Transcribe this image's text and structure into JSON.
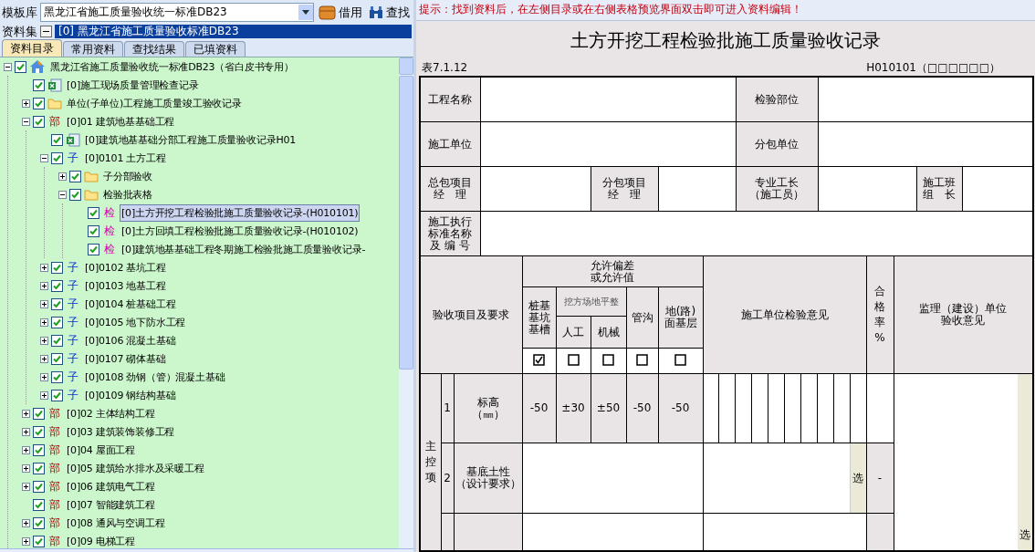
{
  "toolbar": {
    "template_label": "模板库",
    "template_value": "黑龙江省施工质量验收统一标准DB23",
    "borrow_button": "借用",
    "find_button": "查找"
  },
  "dataset": {
    "label": "资料集",
    "value": "[0] 黑龙江省施工质量验收标准DB23"
  },
  "tabs": [
    {
      "label": "资料目录",
      "selected": true
    },
    {
      "label": "常用资料",
      "selected": false
    },
    {
      "label": "查找结果",
      "selected": false
    },
    {
      "label": "已填资料",
      "selected": false
    }
  ],
  "tree": [
    {
      "kind": "root",
      "label": "黑龙江省施工质量验收统一标准DB23（省白皮书专用）",
      "checked": true,
      "expanded": true,
      "selected": false,
      "children": [
        {
          "kind": "file",
          "label": "[0]施工现场质量管理检查记录",
          "checked": true,
          "selected": false
        },
        {
          "kind": "folder",
          "label": "单位(子单位)工程施工质量竣工验收记录",
          "checked": true,
          "expanded": false,
          "selected": false
        },
        {
          "kind": "part",
          "tag": "部",
          "label": "[0]01 建筑地基基础工程",
          "checked": true,
          "expanded": true,
          "selected": false,
          "children": [
            {
              "kind": "file",
              "label": "[0]建筑地基基础分部工程施工质量验收记录H01",
              "checked": true,
              "selected": false
            },
            {
              "kind": "sub",
              "tag": "子",
              "label": "[0]0101 土方工程",
              "checked": true,
              "expanded": true,
              "selected": false,
              "children": [
                {
                  "kind": "folder",
                  "label": "子分部验收",
                  "checked": true,
                  "expanded": false,
                  "selected": false
                },
                {
                  "kind": "folder",
                  "label": "检验批表格",
                  "checked": true,
                  "expanded": true,
                  "selected": false,
                  "children": [
                    {
                      "kind": "check",
                      "tag": "检",
                      "label": "[0]土方开挖工程检验批施工质量验收记录-(H010101)",
                      "checked": true,
                      "selected": true
                    },
                    {
                      "kind": "check",
                      "tag": "检",
                      "label": "[0]土方回填工程检验批施工质量验收记录-(H010102)",
                      "checked": true,
                      "selected": false
                    },
                    {
                      "kind": "check",
                      "tag": "检",
                      "label": "[0]建筑地基基础工程冬期施工检验批施工质量验收记录-",
                      "checked": true,
                      "selected": false
                    }
                  ]
                }
              ]
            },
            {
              "kind": "sub",
              "tag": "子",
              "label": "[0]0102 基坑工程",
              "checked": true,
              "expanded": false,
              "selected": false
            },
            {
              "kind": "sub",
              "tag": "子",
              "label": "[0]0103 地基工程",
              "checked": true,
              "expanded": false,
              "selected": false
            },
            {
              "kind": "sub",
              "tag": "子",
              "label": "[0]0104 桩基础工程",
              "checked": true,
              "expanded": false,
              "selected": false
            },
            {
              "kind": "sub",
              "tag": "子",
              "label": "[0]0105 地下防水工程",
              "checked": true,
              "expanded": false,
              "selected": false
            },
            {
              "kind": "sub",
              "tag": "子",
              "label": "[0]0106 混凝土基础",
              "checked": true,
              "expanded": false,
              "selected": false
            },
            {
              "kind": "sub",
              "tag": "子",
              "label": "[0]0107 砌体基础",
              "checked": true,
              "expanded": false,
              "selected": false
            },
            {
              "kind": "sub",
              "tag": "子",
              "label": "[0]0108 劲钢（管）混凝土基础",
              "checked": true,
              "expanded": false,
              "selected": false
            },
            {
              "kind": "sub",
              "tag": "子",
              "label": "[0]0109 钢结构基础",
              "checked": true,
              "expanded": false,
              "selected": false
            }
          ]
        },
        {
          "kind": "part",
          "tag": "部",
          "label": "[0]02 主体结构工程",
          "checked": true,
          "expanded": false,
          "selected": false
        },
        {
          "kind": "part",
          "tag": "部",
          "label": "[0]03 建筑装饰装修工程",
          "checked": true,
          "expanded": false,
          "selected": false
        },
        {
          "kind": "part",
          "tag": "部",
          "label": "[0]04 屋面工程",
          "checked": true,
          "expanded": false,
          "selected": false
        },
        {
          "kind": "part",
          "tag": "部",
          "label": "[0]05 建筑给水排水及采暖工程",
          "checked": true,
          "expanded": false,
          "selected": false
        },
        {
          "kind": "part",
          "tag": "部",
          "label": "[0]06 建筑电气工程",
          "checked": true,
          "expanded": false,
          "selected": false
        },
        {
          "kind": "part",
          "tag": "部",
          "label": "[0]07 智能建筑工程",
          "checked": true,
          "selected": false
        },
        {
          "kind": "part",
          "tag": "部",
          "label": "[0]08 通风与空调工程",
          "checked": true,
          "expanded": false,
          "selected": false
        },
        {
          "kind": "part",
          "tag": "部",
          "label": "[0]09 电梯工程",
          "checked": true,
          "expanded": false,
          "selected": false
        }
      ]
    }
  ],
  "hint": "提示：找到资料后，在左侧目录或在右侧表格预览界面双击即可进入资料编辑！",
  "form": {
    "title": "土方开挖工程检验批施工质量验收记录",
    "table_no": "表7.1.12",
    "code": "H010101（□□□□□□）",
    "fields": {
      "project_name": [
        "工程名称"
      ],
      "inspection_part": [
        "检验部位"
      ],
      "contractor": [
        "施工单位"
      ],
      "subcontractor": [
        "分包单位"
      ],
      "general_pm": [
        "总包项目",
        "经　理"
      ],
      "sub_pm": [
        "分包项目",
        "经　理"
      ],
      "foreman": [
        "专业工长",
        "（施工员）"
      ],
      "team_leader": [
        "施工班",
        "组　长"
      ],
      "standard": [
        "施工执行",
        "标准名称",
        "及 编 号"
      ]
    },
    "columns": {
      "items": "验收项目及要求",
      "tolerance": [
        "允许偏差",
        "或允许值"
      ],
      "leveling_group": "挖方场地平整",
      "contractor_opinion": "施工单位检验意见",
      "pass_rate": "合格率%",
      "supervisor_opinion": [
        "监理（建设）单位",
        "验收意见"
      ]
    },
    "tolerance_types": [
      {
        "label": [
          "桩基",
          "基坑",
          "基槽"
        ],
        "checked": true
      },
      {
        "label": [
          "人工"
        ],
        "checked": false
      },
      {
        "label": [
          "机械"
        ],
        "checked": false
      },
      {
        "label": [
          "管沟"
        ],
        "checked": false
      },
      {
        "label": [
          "地(路)",
          "面基层"
        ],
        "checked": false
      }
    ],
    "main_control": "主控项",
    "rows": [
      {
        "no": "1",
        "item": [
          "标高",
          "（㎜）"
        ],
        "values": [
          "-50",
          "±30",
          "±50",
          "-50",
          "-50"
        ]
      },
      {
        "no": "2",
        "item": [
          "基底土性",
          "（设计要求）"
        ],
        "pick_button": "选",
        "pass_rate": "-"
      }
    ],
    "supervisor_pick": "选"
  }
}
